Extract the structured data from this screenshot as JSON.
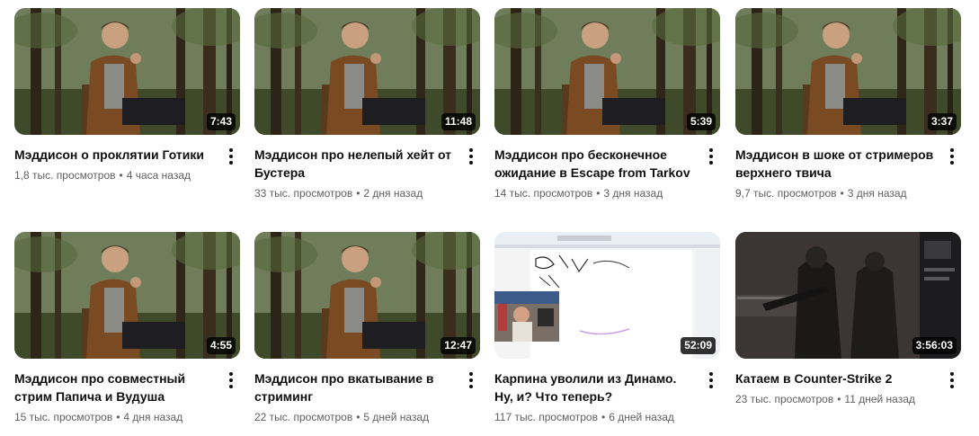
{
  "videos": [
    {
      "title": "Мэддисон о проклятии Готики",
      "views": "1,8 тыс. просмотров",
      "age": "4 часа назад",
      "duration": "7:43",
      "thumb": "forest"
    },
    {
      "title": "Мэддисон про нелепый хейт от Бустера",
      "views": "33 тыс. просмотров",
      "age": "2 дня назад",
      "duration": "11:48",
      "thumb": "forest"
    },
    {
      "title": "Мэддисон про бесконечное ожидание в Escape from Tarkov",
      "views": "14 тыс. просмотров",
      "age": "3 дня назад",
      "duration": "5:39",
      "thumb": "forest"
    },
    {
      "title": "Мэддисон в шоке от стримеров верхнего твича",
      "views": "9,7 тыс. просмотров",
      "age": "3 дня назад",
      "duration": "3:37",
      "thumb": "forest"
    },
    {
      "title": "Мэддисон про совместный стрим Папича и Вудуша",
      "views": "15 тыс. просмотров",
      "age": "4 дня назад",
      "duration": "4:55",
      "thumb": "forest"
    },
    {
      "title": "Мэддисон про вкатывание в стриминг",
      "views": "22 тыс. просмотров",
      "age": "5 дней назад",
      "duration": "12:47",
      "thumb": "forest"
    },
    {
      "title": "Карпина уволили из Динамо. Ну, и? Что теперь?",
      "views": "117 тыс. просмотров",
      "age": "6 дней назад",
      "duration": "52:09",
      "thumb": "paint"
    },
    {
      "title": "Катаем в Counter-Strike 2",
      "views": "23 тыс. просмотров",
      "age": "11 дней назад",
      "duration": "3:56:03",
      "thumb": "cs"
    }
  ],
  "separator": "•",
  "colors": {
    "title": "#0f0f0f",
    "meta": "#606060",
    "badge_bg": "#000000cc"
  },
  "icons": {
    "menu": "more-vert-icon"
  }
}
